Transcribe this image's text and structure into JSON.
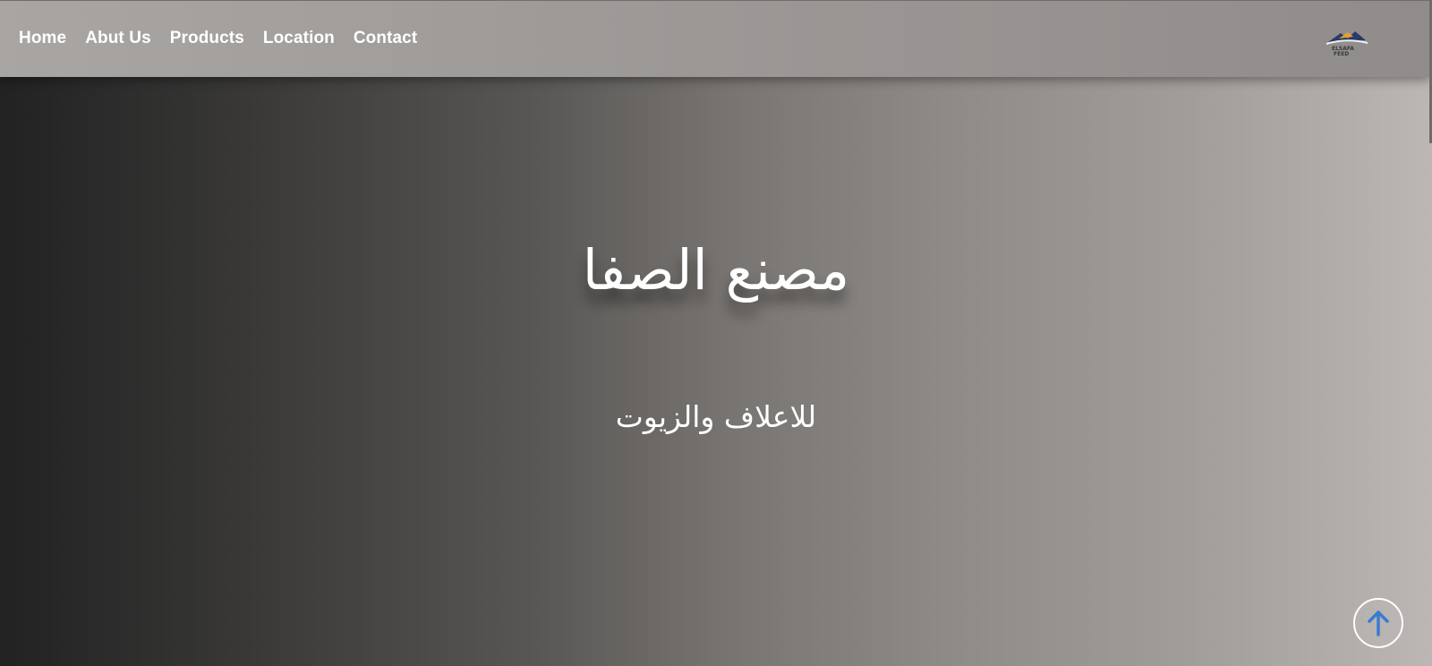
{
  "nav": {
    "links": [
      "Home",
      "Abut Us",
      "Products",
      "Location",
      "Contact"
    ]
  },
  "logo": {
    "icon": "elsafa-feed-logo",
    "text_line1": "ELSAFA",
    "text_line2": "FEED"
  },
  "hero": {
    "title": "مصنع الصفا",
    "subtitle": "للاعلاف والزيوت"
  },
  "scroll_top": {
    "icon": "arrow-up-icon",
    "accent": "#3b7ad1"
  },
  "colors": {
    "navbar": "#9e9a98",
    "hero_dark": "#222222",
    "hero_light": "#bcb7b4",
    "text": "#ffffff"
  }
}
